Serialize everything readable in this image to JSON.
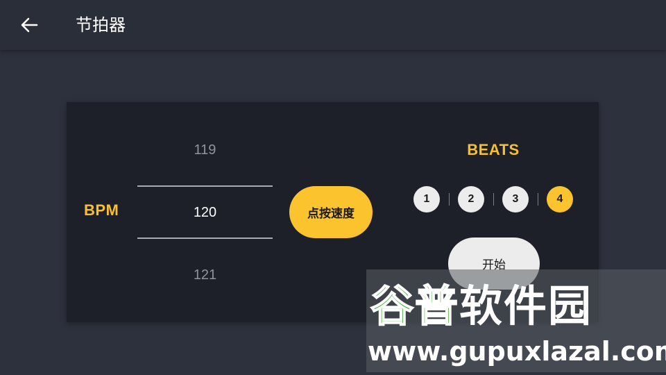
{
  "appbar": {
    "back_icon": "arrow-left-icon",
    "title": "节拍器"
  },
  "bpm": {
    "label": "BPM",
    "prev": "119",
    "current": "120",
    "next": "121"
  },
  "tap_tempo": {
    "label": "点按速度"
  },
  "beats": {
    "label": "BEATS",
    "items": [
      "1",
      "2",
      "3",
      "4"
    ],
    "selected": "4"
  },
  "start": {
    "label": "开始"
  },
  "watermark": {
    "logo_text": "谷普软件园",
    "url": "www.gupuxlazal.com"
  },
  "colors": {
    "background": "#2d313d",
    "appbar": "#2a2e39",
    "card": "#1e2029",
    "accent": "#fbc42f",
    "button_light": "#ececec"
  }
}
